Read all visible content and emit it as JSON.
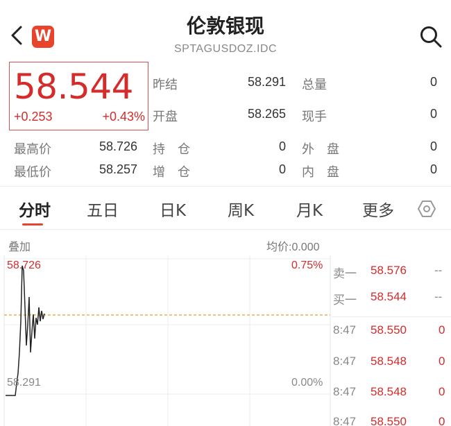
{
  "header": {
    "title": "伦敦银现",
    "code": "SPTAGUSDOZ.IDC",
    "logo_letter": "W"
  },
  "quote": {
    "price": "58.544",
    "change": "+0.253",
    "change_pct": "+0.43%"
  },
  "stats": {
    "prev_close_label": "昨结",
    "prev_close": "58.291",
    "total_vol_label": "总量",
    "total_vol": "0",
    "open_label": "开盘",
    "open": "58.265",
    "current_hand_label": "现手",
    "current_hand": "0",
    "high_label": "最高价",
    "high": "58.726",
    "position_label": "持　仓",
    "position": "0",
    "outer_label": "外　盘",
    "outer": "0",
    "low_label": "最低价",
    "low": "58.257",
    "increase_label": "增　仓",
    "increase": "0",
    "inner_label": "内　盘",
    "inner": "0"
  },
  "tabs": [
    "分时",
    "五日",
    "日K",
    "周K",
    "月K",
    "更多"
  ],
  "chart": {
    "overlay_label": "叠加",
    "avg_label": "均价:0.000",
    "top_price": "58.726",
    "bottom_price": "58.291",
    "top_pct": "0.75%",
    "bottom_pct": "0.00%"
  },
  "book": {
    "ask1_label": "卖一",
    "ask1_price": "58.576",
    "ask1_vol": "--",
    "bid1_label": "买一",
    "bid1_price": "58.544",
    "bid1_vol": "--",
    "trades": [
      {
        "time": "8:47",
        "price": "58.550",
        "vol": "0"
      },
      {
        "time": "8:47",
        "price": "58.548",
        "vol": "0"
      },
      {
        "time": "8:47",
        "price": "58.548",
        "vol": "0"
      },
      {
        "time": "8:47",
        "price": "58.550",
        "vol": "0"
      }
    ]
  },
  "colors": {
    "up": "#d42b2b",
    "accent": "#e8432b",
    "avg_line": "#e0a030"
  },
  "icons": [
    "back-icon",
    "search-icon",
    "settings-hexagon-icon"
  ]
}
